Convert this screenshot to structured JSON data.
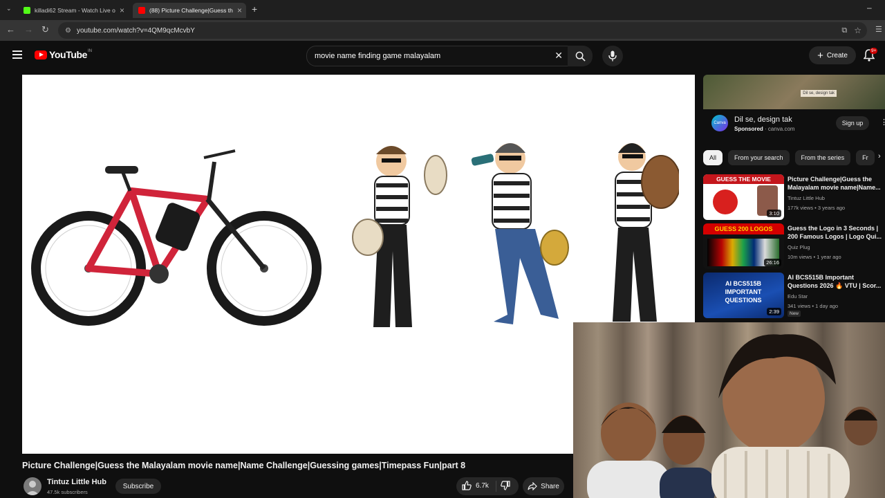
{
  "browser": {
    "tabs": [
      {
        "title": "killadi62 Stream - Watch Live o",
        "active": false,
        "favicon_color": "#53fc18"
      },
      {
        "title": "(88) Picture Challenge|Guess th",
        "active": true,
        "favicon_color": "#ff0000"
      }
    ],
    "new_tab": "+",
    "address": "youtube.com/watch?v=4QM9qcMcvbY"
  },
  "header": {
    "logo_text": "YouTube",
    "country_code": "IN",
    "search_query": "movie name finding game malayalam",
    "create_label": "Create",
    "notifications": "9+"
  },
  "video": {
    "title": "Picture Challenge|Guess the Malayalam movie name|Name Challenge|Guessing games|Timepass Fun|part 8",
    "channel": "Tintuz Little Hub",
    "subscribers": "47.5k subscribers",
    "subscribe_label": "Subscribe",
    "likes": "6.7k",
    "share_label": "Share"
  },
  "ad": {
    "banner_tag": "Dil se, design tak",
    "logo_text": "Canva",
    "title": "Dil se, design tak",
    "sponsored": "Sponsored",
    "domain": "canva.com",
    "cta": "Sign up"
  },
  "chips": [
    "All",
    "From your search",
    "From the series",
    "Fr"
  ],
  "recommendations": [
    {
      "title": "Picture Challenge|Guess the Malayalam movie name|Name...",
      "channel": "Tintuz Little Hub",
      "meta": "177k views • 3 years ago",
      "duration": "3:10",
      "thumb_text": "GUESS THE MOVIE",
      "new": ""
    },
    {
      "title": "Guess the Logo in 3 Seconds | 200 Famous Logos | Logo Qui...",
      "channel": "Quiz Plug",
      "meta": "10m views • 1 year ago",
      "duration": "26:16",
      "thumb_text": "GUESS 200 LOGOS",
      "new": ""
    },
    {
      "title": "AI BCS515B Important Questions 2026 🔥 VTU | Scor...",
      "channel": "Edu Star",
      "meta": "341 views • 1 day ago",
      "duration": "2:39",
      "thumb_text": "AI BCS515B IMPORTANT QUESTIONS",
      "new": "New"
    }
  ],
  "colors": {
    "accent": "#ff0000",
    "background": "#0f0f0f",
    "chip": "#272727"
  }
}
